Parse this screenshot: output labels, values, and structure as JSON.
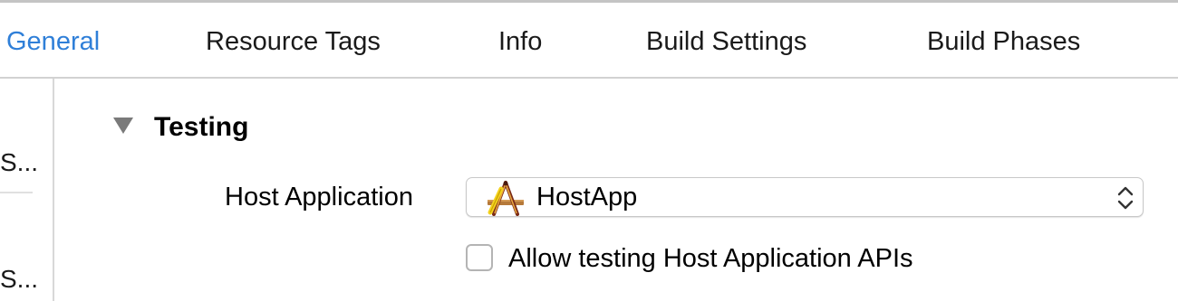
{
  "tabs": {
    "general": "General",
    "resource_tags": "Resource Tags",
    "info": "Info",
    "build_settings": "Build Settings",
    "build_phases": "Build Phases",
    "active": "General",
    "active_color": "#2f7fd8"
  },
  "sidebar": {
    "items": [
      {
        "label": "S..."
      },
      {
        "label": "S..."
      }
    ]
  },
  "testing": {
    "section_title": "Testing",
    "disclosure_icon": "disclosure-triangle-down",
    "host_application_label": "Host Application",
    "host_application_value": "HostApp",
    "host_application_icon": "app-icon",
    "allow_testing_label": "Allow testing Host Application APIs",
    "allow_testing_checked": false
  }
}
